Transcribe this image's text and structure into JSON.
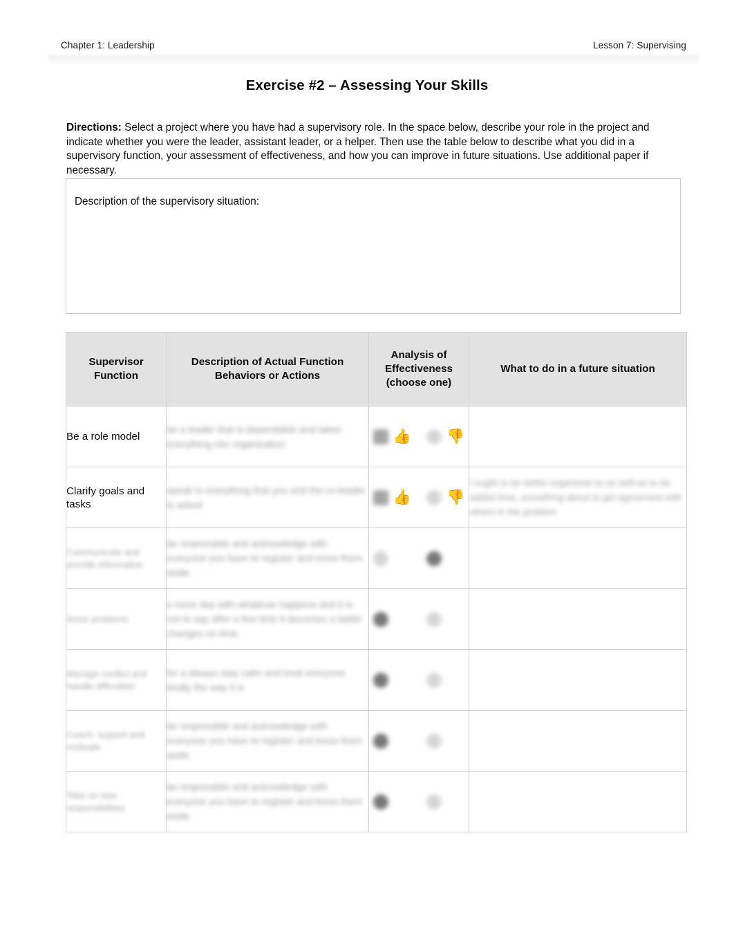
{
  "running_head": {
    "left": "Chapter 1: Leadership",
    "right": "Lesson 7: Supervising"
  },
  "title": "Exercise #2 – Assessing Your Skills",
  "directions": {
    "label": "Directions:",
    "text": " Select a project where you have had a supervisory role. In the space below, describe your role in the project and indicate whether you were the leader, assistant leader, or a helper. Then use the table below to describe what you did in a supervisory function, your assessment of effectiveness, and how you can improve in future situations. Use additional paper if necessary."
  },
  "description_box": {
    "label": "Description of the supervisory situation:",
    "value": ""
  },
  "table": {
    "headers": [
      "Supervisor Function",
      "Description of Actual Function Behaviors or Actions",
      "Analysis of Effectiveness (choose one)",
      "What to do in a future situation"
    ],
    "header_lines": {
      "h1": [
        "Supervisor",
        "Function"
      ],
      "h2": [
        "Description of Actual Function",
        "Behaviors or Actions"
      ],
      "h3": [
        "Analysis of",
        "Effectiveness",
        "(choose one)"
      ],
      "h4": [
        "What to do in a future situation"
      ]
    },
    "icons": {
      "thumbs_up": "thumbs-up-icon",
      "thumbs_down": "thumbs-down-icon",
      "thumbs_up_glyph": "👍",
      "thumbs_down_glyph": "👎"
    },
    "rows": [
      {
        "function": "Be a role model",
        "function_legible": true,
        "description": "be a leader that is dependable and takes everything into organization",
        "description_legible": false,
        "effectiveness": "up",
        "future": "",
        "future_legible": true
      },
      {
        "function": "Clarify goals and tasks",
        "function_legible": true,
        "description": "speak to everything that you and the co-leader is asked",
        "description_legible": false,
        "effectiveness": "up",
        "future": "I ought to be better organized so as well as to be added time, something about to get agreement with others in the problem",
        "future_legible": false
      },
      {
        "function": "Communicate and provide information",
        "function_legible": false,
        "description": "be responsible and acknowledge with everyone you have to register and know them aside",
        "description_legible": false,
        "effectiveness": "down",
        "future": "",
        "future_legible": true
      },
      {
        "function": "Solve problems",
        "function_legible": false,
        "description": "a more day with whatever happens and it is not to say after a few time it becomes a better changes on time",
        "description_legible": false,
        "effectiveness": "up",
        "future": "",
        "future_legible": true
      },
      {
        "function": "Manage conflict and handle difficulties",
        "function_legible": false,
        "description": "for a always stay calm and treat everyone kindly the way it is",
        "description_legible": false,
        "effectiveness": "up",
        "future": "",
        "future_legible": true
      },
      {
        "function": "Coach, support and motivate",
        "function_legible": false,
        "description": "be responsible and acknowledge with everyone you have to register and know them aside",
        "description_legible": false,
        "effectiveness": "up",
        "future": "",
        "future_legible": true
      },
      {
        "function": "Take on new responsibilities",
        "function_legible": false,
        "description": "be responsible and acknowledge with everyone you have to register and know them aside",
        "description_legible": false,
        "effectiveness": "up",
        "future": "",
        "future_legible": true
      }
    ]
  },
  "colors": {
    "header_fill": "#e2e2e2",
    "border": "#d2d2d2",
    "text": "#0d0d0d",
    "page_bg": "#ffffff"
  }
}
